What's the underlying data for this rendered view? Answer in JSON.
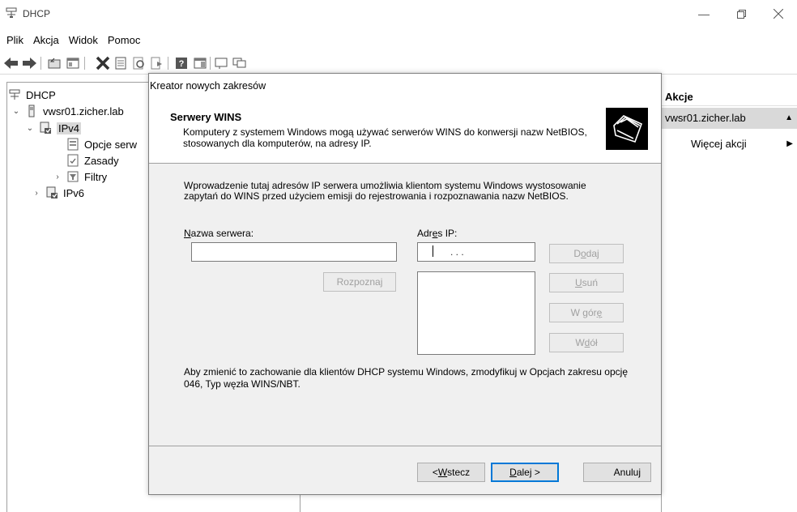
{
  "window": {
    "title": "DHCP",
    "minimize_glyph": "—",
    "maximize_glyph": "🗗",
    "close_glyph": "✕"
  },
  "menu": [
    "Plik",
    "Akcja",
    "Widok",
    "Pomoc"
  ],
  "toolbar_icons": [
    "back-arrow-icon",
    "forward-arrow-icon",
    "up-folder-icon",
    "console-tree-icon",
    "delete-icon",
    "properties-icon",
    "refresh-icon",
    "export-icon",
    "help-icon",
    "action-pane-icon",
    "view-icon",
    "filter-icon"
  ],
  "tree": {
    "root": "DHCP",
    "server": "vwsr01.zicher.lab",
    "ipv4": "IPv4",
    "options": "Opcje serw",
    "policies": "Zasady",
    "filters": "Filtry",
    "ipv6": "IPv6"
  },
  "actions": {
    "header": "Akcje",
    "server": "vwsr01.zicher.lab",
    "more": "Więcej akcji"
  },
  "wizard": {
    "title": "Kreator nowych zakresów",
    "header_title": "Serwery WINS",
    "header_desc": "Komputery z systemem Windows mogą używać serwerów WINS do konwersji nazw NetBIOS, stosowanych dla komputerów, na adresy IP.",
    "intro": "Wprowadzenie tutaj adresów IP serwera umożliwia klientom systemu Windows wystosowanie zapytań do WINS przed użyciem emisji do rejestrowania i rozpoznawania nazw NetBIOS.",
    "server_name_label_u": "N",
    "server_name_label_rest": "azwa serwera:",
    "server_name_value": "",
    "ip_label_pre": "Adr",
    "ip_label_u": "e",
    "ip_label_post": "s IP:",
    "ip_value": ".   .   .",
    "resolve_pre": "Rozpozna",
    "resolve_u": "j",
    "add_pre": "D",
    "add_u": "o",
    "add_post": "daj",
    "remove_u": "U",
    "remove_post": "suń",
    "up_pre": "W gór",
    "up_u": "ę",
    "down_pre": "W ",
    "down_u": "d",
    "down_post": "ół",
    "note": "Aby zmienić to zachowanie dla klientów DHCP systemu Windows, zmodyfikuj w Opcjach zakresu opcję 046, Typ węzła WINS/NBT.",
    "back_pre": "< ",
    "back_u": "W",
    "back_post": "stecz",
    "next_u": "D",
    "next_post": "alej >",
    "cancel": "Anuluj"
  }
}
